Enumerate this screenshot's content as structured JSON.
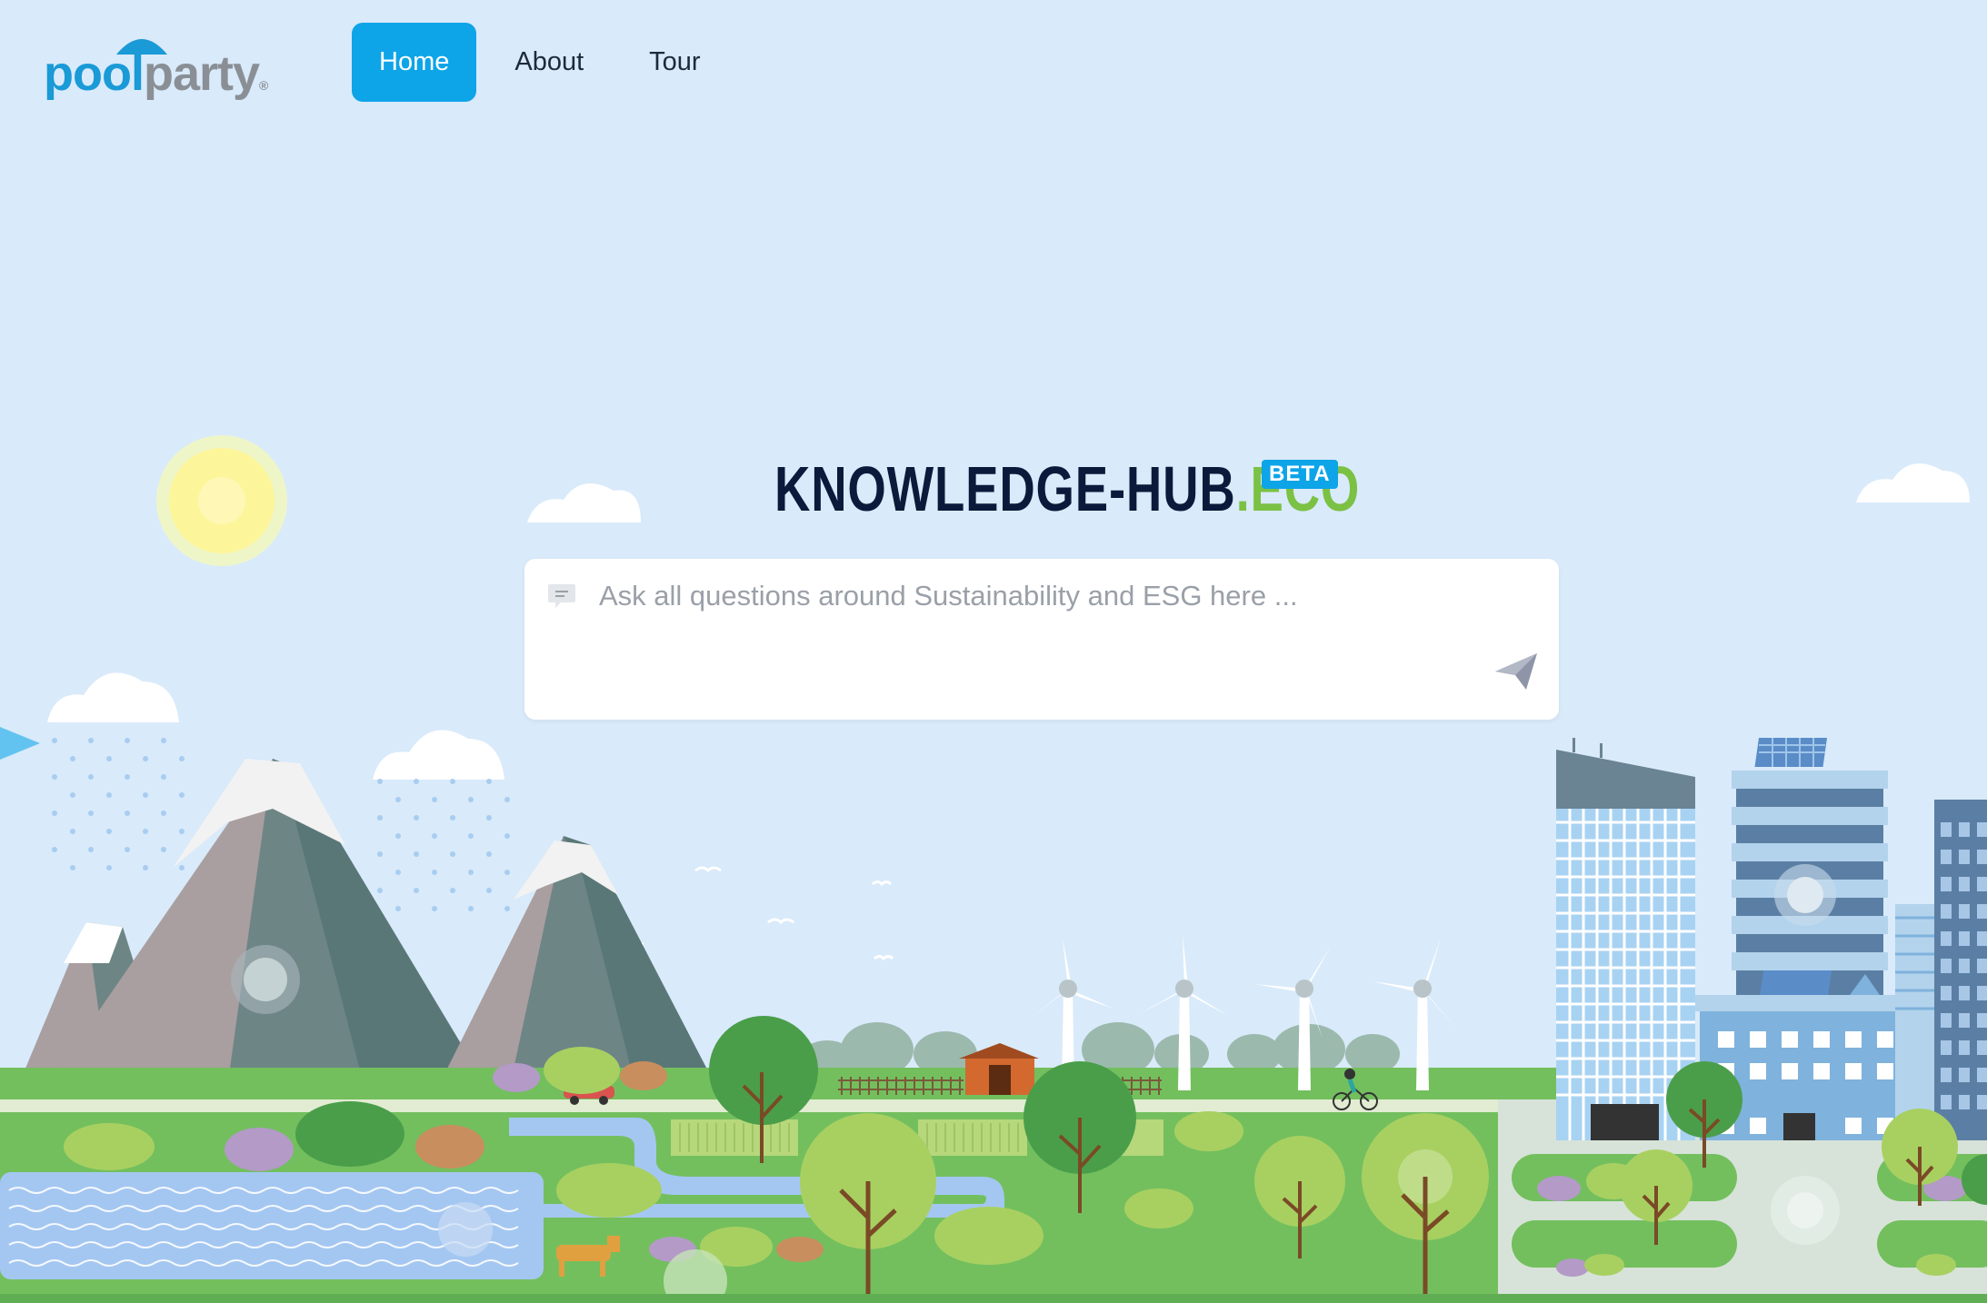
{
  "brand": {
    "logo_pool": "pool",
    "logo_party": "party",
    "logo_reg": "®"
  },
  "nav": {
    "items": [
      {
        "label": "Home",
        "active": true
      },
      {
        "label": "About",
        "active": false
      },
      {
        "label": "Tour",
        "active": false
      }
    ]
  },
  "hero": {
    "title_main": "KNOWLEDGE-HUB",
    "title_suffix": ".ECO",
    "badge": "BETA"
  },
  "search": {
    "placeholder": "Ask all questions around Sustainability and ESG here ...",
    "value": ""
  },
  "colors": {
    "sky": "#d9eafa",
    "accent": "#0ea4e8",
    "eco_green": "#7bc144",
    "title_dark": "#0b1a3a"
  },
  "icons": {
    "message": "message-icon",
    "send": "send-icon"
  }
}
